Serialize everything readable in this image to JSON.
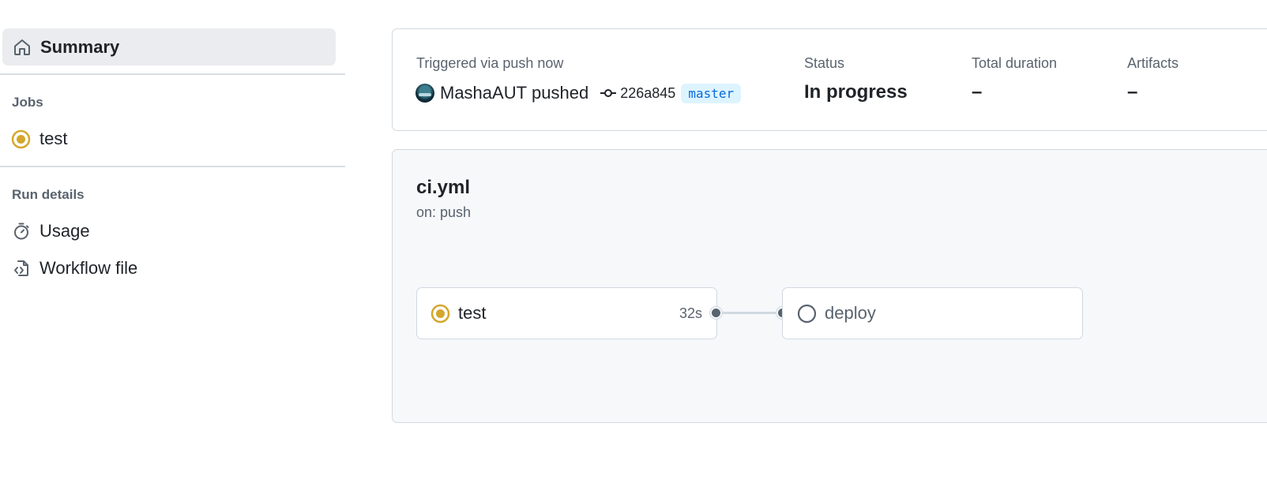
{
  "sidebar": {
    "summary_label": "Summary",
    "jobs_heading": "Jobs",
    "jobs": [
      {
        "label": "test",
        "status": "in-progress"
      }
    ],
    "run_details_heading": "Run details",
    "usage_label": "Usage",
    "workflow_file_label": "Workflow file"
  },
  "summary": {
    "trigger_text": "Triggered via push now",
    "actor": "MashaAUT",
    "action": "pushed",
    "commit_sha": "226a845",
    "branch": "master",
    "status_label": "Status",
    "status_value": "In progress",
    "duration_label": "Total duration",
    "duration_value": "–",
    "artifacts_label": "Artifacts",
    "artifacts_value": "–"
  },
  "workflow": {
    "file_name": "ci.yml",
    "trigger": "on: push",
    "jobs": [
      {
        "name": "test",
        "duration": "32s",
        "status": "in-progress"
      },
      {
        "name": "deploy",
        "status": "queued"
      }
    ]
  },
  "colors": {
    "in_progress": "#d4a72c",
    "branch_text": "#0969da",
    "branch_bg": "#ddf4ff",
    "muted": "#59636e"
  }
}
